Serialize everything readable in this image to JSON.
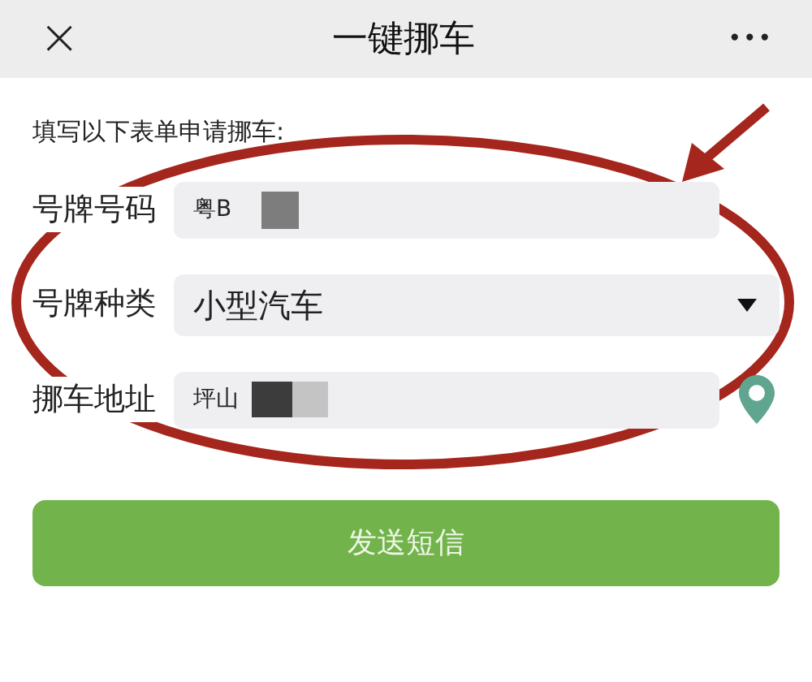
{
  "header": {
    "close": "×",
    "title": "一键挪车",
    "more": "•••"
  },
  "intro": "填写以下表单申请挪车:",
  "fields": [
    {
      "kind": "text",
      "label": "号牌号码",
      "value": "粤B"
    },
    {
      "kind": "select",
      "label": "号牌种类",
      "value": "小型汽车"
    },
    {
      "kind": "location",
      "label": "挪车地址",
      "value": "坪山"
    }
  ],
  "submit": "发送短信"
}
